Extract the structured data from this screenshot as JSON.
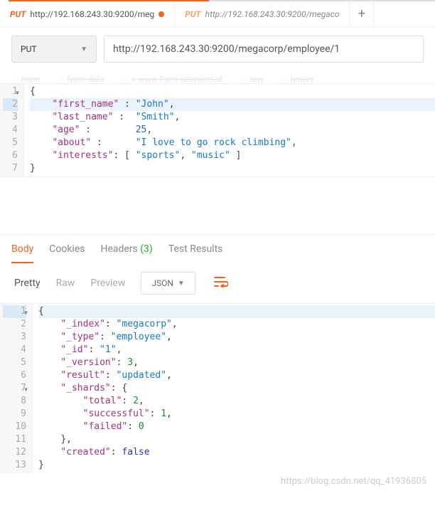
{
  "tabs": [
    {
      "method": "PUT",
      "label": "http://192.168.243.30:9200/meg",
      "modified": true
    },
    {
      "method": "PUT",
      "label": "http://192.168.243.30:9200/megaco",
      "modified": false
    }
  ],
  "add_tab_glyph": "+",
  "request": {
    "method": "PUT",
    "url": "http://192.168.243.30:9200/megacorp/employee/1"
  },
  "body_type_options": [
    "none",
    "form-data",
    "x-www-form-urlencoded",
    "raw",
    "binary"
  ],
  "request_body_lines": [
    {
      "n": "1",
      "fold": true,
      "text": [
        {
          "c": "bracket",
          "t": "{"
        }
      ]
    },
    {
      "n": "2",
      "sel": true,
      "text": [
        {
          "c": "pad",
          "t": "    "
        },
        {
          "c": "k",
          "t": "\"first_name\""
        },
        {
          "c": "p",
          "t": " : "
        },
        {
          "c": "s",
          "t": "\"John\""
        },
        {
          "c": "p",
          "t": ","
        }
      ]
    },
    {
      "n": "3",
      "text": [
        {
          "c": "pad",
          "t": "    "
        },
        {
          "c": "k",
          "t": "\"last_name\""
        },
        {
          "c": "p",
          "t": " :  "
        },
        {
          "c": "s",
          "t": "\"Smith\""
        },
        {
          "c": "p",
          "t": ","
        }
      ]
    },
    {
      "n": "4",
      "text": [
        {
          "c": "pad",
          "t": "    "
        },
        {
          "c": "k",
          "t": "\"age\""
        },
        {
          "c": "p",
          "t": " :        "
        },
        {
          "c": "n",
          "t": "25"
        },
        {
          "c": "p",
          "t": ","
        }
      ]
    },
    {
      "n": "5",
      "text": [
        {
          "c": "pad",
          "t": "    "
        },
        {
          "c": "k",
          "t": "\"about\""
        },
        {
          "c": "p",
          "t": " :      "
        },
        {
          "c": "s",
          "t": "\"I love to go rock climbing\""
        },
        {
          "c": "p",
          "t": ","
        }
      ]
    },
    {
      "n": "6",
      "text": [
        {
          "c": "pad",
          "t": "    "
        },
        {
          "c": "k",
          "t": "\"interests\""
        },
        {
          "c": "p",
          "t": ": [ "
        },
        {
          "c": "s",
          "t": "\"sports\""
        },
        {
          "c": "p",
          "t": ", "
        },
        {
          "c": "s",
          "t": "\"music\""
        },
        {
          "c": "p",
          "t": " ]"
        }
      ]
    },
    {
      "n": "7",
      "text": [
        {
          "c": "bracket",
          "t": "}"
        }
      ]
    }
  ],
  "response_tabs": {
    "items": [
      "Body",
      "Cookies",
      "Headers",
      "Test Results"
    ],
    "active": "Body",
    "headers_count": "(3)"
  },
  "view_modes": {
    "items": [
      "Pretty",
      "Raw",
      "Preview"
    ],
    "active": "Pretty"
  },
  "format_select": "JSON",
  "response_body_lines": [
    {
      "n": "1",
      "fold": true,
      "sel": true,
      "text": [
        {
          "c": "bracket",
          "t": "{"
        }
      ]
    },
    {
      "n": "2",
      "text": [
        {
          "c": "pad",
          "t": "    "
        },
        {
          "c": "k",
          "t": "\"_index\""
        },
        {
          "c": "p",
          "t": ": "
        },
        {
          "c": "s",
          "t": "\"megacorp\""
        },
        {
          "c": "p",
          "t": ","
        }
      ]
    },
    {
      "n": "3",
      "text": [
        {
          "c": "pad",
          "t": "    "
        },
        {
          "c": "k",
          "t": "\"_type\""
        },
        {
          "c": "p",
          "t": ": "
        },
        {
          "c": "s",
          "t": "\"employee\""
        },
        {
          "c": "p",
          "t": ","
        }
      ]
    },
    {
      "n": "4",
      "text": [
        {
          "c": "pad",
          "t": "    "
        },
        {
          "c": "k",
          "t": "\"_id\""
        },
        {
          "c": "p",
          "t": ": "
        },
        {
          "c": "s",
          "t": "\"1\""
        },
        {
          "c": "p",
          "t": ","
        }
      ]
    },
    {
      "n": "5",
      "text": [
        {
          "c": "pad",
          "t": "    "
        },
        {
          "c": "k",
          "t": "\"_version\""
        },
        {
          "c": "p",
          "t": ": "
        },
        {
          "c": "g",
          "t": "3"
        },
        {
          "c": "p",
          "t": ","
        }
      ]
    },
    {
      "n": "6",
      "text": [
        {
          "c": "pad",
          "t": "    "
        },
        {
          "c": "k",
          "t": "\"result\""
        },
        {
          "c": "p",
          "t": ": "
        },
        {
          "c": "s",
          "t": "\"updated\""
        },
        {
          "c": "p",
          "t": ","
        }
      ]
    },
    {
      "n": "7",
      "fold": true,
      "text": [
        {
          "c": "pad",
          "t": "    "
        },
        {
          "c": "k",
          "t": "\"_shards\""
        },
        {
          "c": "p",
          "t": ": {"
        }
      ]
    },
    {
      "n": "8",
      "text": [
        {
          "c": "pad",
          "t": "        "
        },
        {
          "c": "k",
          "t": "\"total\""
        },
        {
          "c": "p",
          "t": ": "
        },
        {
          "c": "g",
          "t": "2"
        },
        {
          "c": "p",
          "t": ","
        }
      ]
    },
    {
      "n": "9",
      "text": [
        {
          "c": "pad",
          "t": "        "
        },
        {
          "c": "k",
          "t": "\"successful\""
        },
        {
          "c": "p",
          "t": ": "
        },
        {
          "c": "g",
          "t": "1"
        },
        {
          "c": "p",
          "t": ","
        }
      ]
    },
    {
      "n": "10",
      "text": [
        {
          "c": "pad",
          "t": "        "
        },
        {
          "c": "k",
          "t": "\"failed\""
        },
        {
          "c": "p",
          "t": ": "
        },
        {
          "c": "g",
          "t": "0"
        }
      ]
    },
    {
      "n": "11",
      "text": [
        {
          "c": "pad",
          "t": "    "
        },
        {
          "c": "p",
          "t": "},"
        }
      ]
    },
    {
      "n": "12",
      "text": [
        {
          "c": "pad",
          "t": "    "
        },
        {
          "c": "k",
          "t": "\"created\""
        },
        {
          "c": "p",
          "t": ": "
        },
        {
          "c": "bl",
          "t": "false"
        }
      ]
    },
    {
      "n": "13",
      "text": [
        {
          "c": "bracket",
          "t": "}"
        }
      ]
    }
  ],
  "watermark": "https://blog.csdn.net/qq_41936805"
}
